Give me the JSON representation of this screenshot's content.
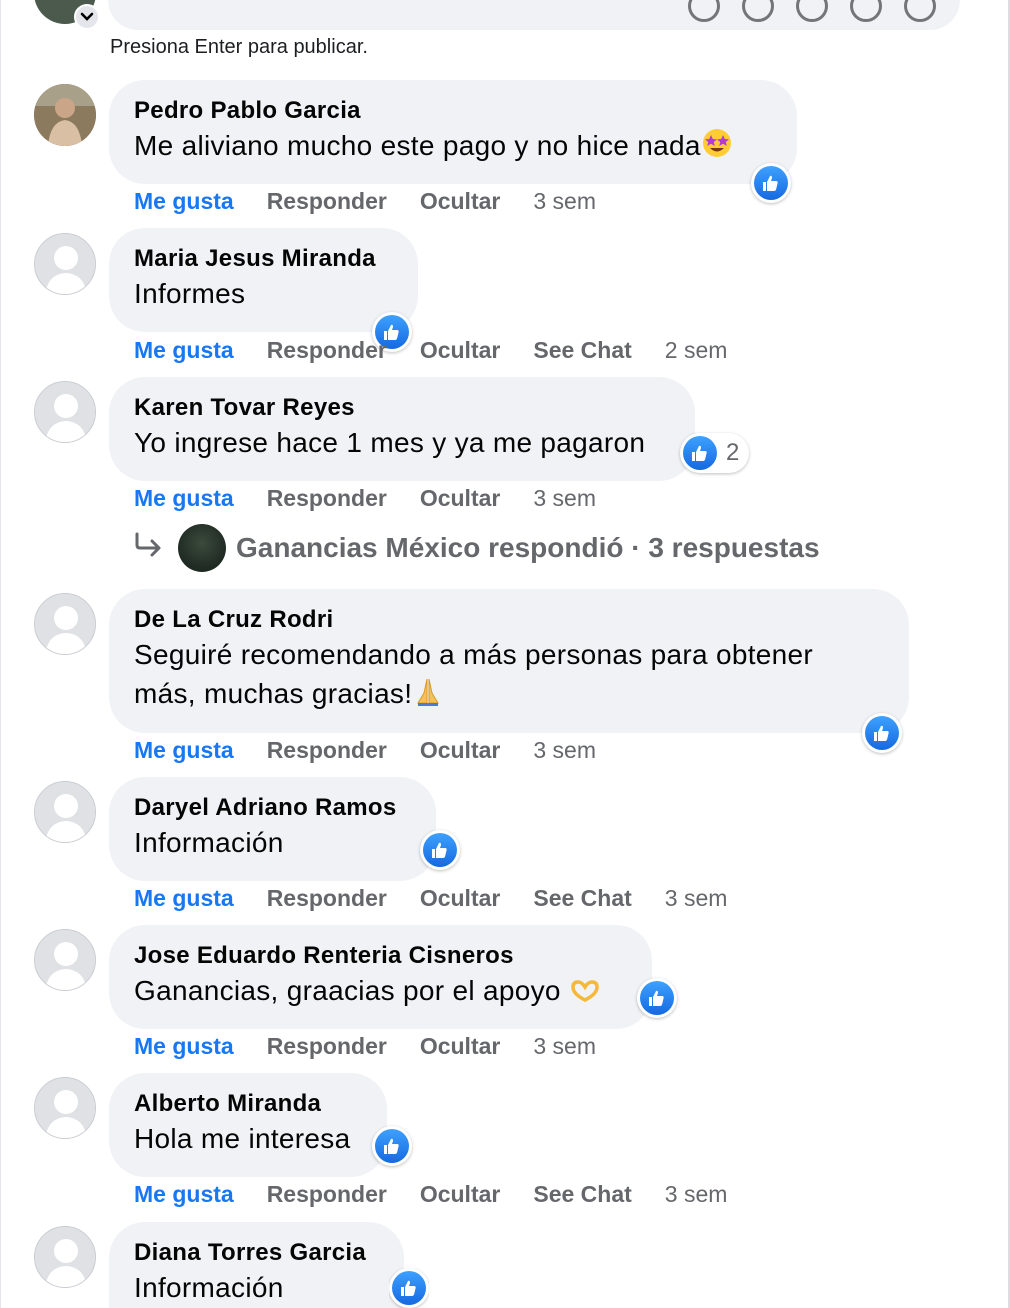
{
  "composer": {
    "hint": "Presiona Enter para publicar."
  },
  "comments": [
    {
      "author": "Pedro Pablo Garcia",
      "lines": [
        "Me aliviano mucho este pago y no hice nada"
      ],
      "emoji": "star-struck-emoji",
      "like_label": "Me gusta",
      "reply_label": "Responder",
      "hide_label": "Ocultar",
      "time": "3 sem",
      "reactions": ""
    },
    {
      "author": "Maria Jesus Miranda",
      "lines": [
        "Informes"
      ],
      "like_label": "Me gusta",
      "reply_label": "Responder",
      "hide_label": "Ocultar",
      "chat_label": "See Chat",
      "time": "2 sem",
      "reactions": ""
    },
    {
      "author": "Karen Tovar Reyes",
      "lines": [
        "Yo ingrese hace 1 mes y ya me pagaron"
      ],
      "like_label": "Me gusta",
      "reply_label": "Responder",
      "hide_label": "Ocultar",
      "time": "3 sem",
      "reactions": "2"
    },
    {
      "author": "De La Cruz Rodri",
      "lines": [
        "Seguiré recomendando a más personas para obtener",
        "más, muchas gracias!"
      ],
      "emoji": "folded-hands-emoji",
      "like_label": "Me gusta",
      "reply_label": "Responder",
      "hide_label": "Ocultar",
      "time": "3 sem",
      "reactions": ""
    },
    {
      "author": "Daryel Adriano Ramos",
      "lines": [
        "Información"
      ],
      "like_label": "Me gusta",
      "reply_label": "Responder",
      "hide_label": "Ocultar",
      "chat_label": "See Chat",
      "time": "3 sem",
      "reactions": ""
    },
    {
      "author": "Jose Eduardo Renteria Cisneros",
      "lines": [
        "Ganancias, graacias por el apoyo"
      ],
      "emoji": "heart-hands-emoji",
      "like_label": "Me gusta",
      "reply_label": "Responder",
      "hide_label": "Ocultar",
      "time": "3 sem",
      "reactions": ""
    },
    {
      "author": "Alberto Miranda",
      "lines": [
        "Hola me interesa"
      ],
      "like_label": "Me gusta",
      "reply_label": "Responder",
      "hide_label": "Ocultar",
      "chat_label": "See Chat",
      "time": "3 sem",
      "reactions": ""
    },
    {
      "author": "Diana Torres Garcia",
      "lines": [
        "Información"
      ],
      "reactions": ""
    }
  ],
  "replies_summary": {
    "text": "Ganancias México respondió · 3 respuestas"
  },
  "colors": {
    "like_blue": "#1877f2",
    "bubble_bg": "#f0f2f5",
    "muted_text": "#65676b"
  }
}
